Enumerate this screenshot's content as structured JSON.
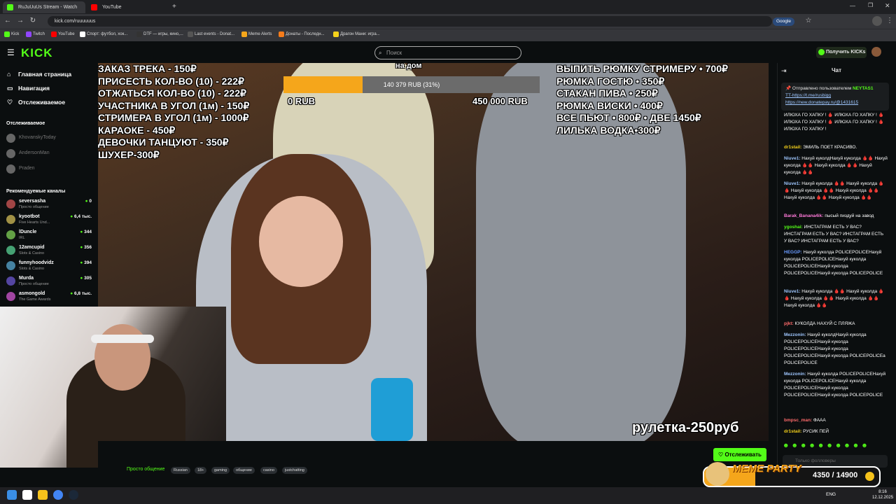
{
  "browser": {
    "tabs": [
      {
        "title": "RuJuUuUs Stream - Watch",
        "icon_color": "#53fc18"
      },
      {
        "title": "YouTube",
        "icon_color": "#ff0000"
      }
    ],
    "url": "kick.com/ruuuuuus",
    "google_badge": "Google",
    "bookmarks": [
      {
        "label": "Kick",
        "icon_color": "#53fc18"
      },
      {
        "label": "Twitch",
        "icon_color": "#9146ff"
      },
      {
        "label": "YouTube",
        "icon_color": "#ff0000"
      },
      {
        "label": "Спорт: футбол, хок...",
        "icon_color": "#ffffff"
      },
      {
        "label": "DTF — игры, кино,...",
        "icon_color": "#333333"
      },
      {
        "label": "Last events - Donat...",
        "icon_color": "#555555"
      },
      {
        "label": "Meme Alerts",
        "icon_color": "#f5a61b"
      },
      {
        "label": "Донаты - Последн...",
        "icon_color": "#f57c1b"
      },
      {
        "label": "Драгон Мани: игра...",
        "icon_color": "#f5d21b"
      }
    ]
  },
  "header": {
    "logo": "KICK",
    "search_placeholder": "Поиск",
    "get_kicks": "Получить KICKs"
  },
  "sidebar": {
    "nav": [
      "Главная страница",
      "Навигация",
      "Отслеживаемое"
    ],
    "following_title": "Отслеживаемое",
    "following": [
      "KhovanskyToday",
      "AndersonMan",
      "Praden"
    ],
    "recommended_title": "Рекомендуемые каналы",
    "recommended": [
      {
        "name": "seversasha",
        "category": "Просто общение",
        "viewers": "0"
      },
      {
        "name": "kyootbot",
        "category": "Five Hearts Und...",
        "viewers": "6,4 тыс."
      },
      {
        "name": "lDuncle",
        "category": "IRL",
        "viewers": "344"
      },
      {
        "name": "12amcupid",
        "category": "Slots & Casino",
        "viewers": "356"
      },
      {
        "name": "funnyhoodvidz",
        "category": "Slots & Casino",
        "viewers": "394"
      },
      {
        "name": "Murda",
        "category": "Просто общение",
        "viewers": "305"
      },
      {
        "name": "asmongold",
        "category": "The Game Awards",
        "viewers": "6,8 тыс."
      }
    ]
  },
  "stream": {
    "price_list_left": [
      "ЗАКАЗ ТРЕКА - 150₽",
      "ПРИСЕСТЬ КОЛ-ВО (10) - 222₽",
      "ОТЖАТЬСЯ КОЛ-ВО (10) - 222₽",
      "УЧАСТНИКА В УГОЛ (1м)  - 150₽",
      "СТРИМЕРА В УГОЛ (1м) - 1000₽",
      "КАРАОКЕ - 450₽",
      "ДЕВОЧКИ ТАНЦУЮТ - 350₽",
      "ШУХЕР-300₽"
    ],
    "price_list_right": [
      "ВЫПИТЬ РЮМКУ СТРИМЕРУ • 700₽",
      "РЮМКА ГОСТЮ • 350₽",
      "СТАКАН ПИВА • 250₽",
      "РЮМКА ВИСКИ • 400₽",
      "ВСЕ ПЬЮТ • 800₽ • ДВЕ 1450₽",
      "ЛИЛЬКА ВОДКА•300₽"
    ],
    "donation_goal_title": "на дом",
    "donation_progress_text": "140 379 RUB (31%)",
    "donation_progress": 0.31,
    "donation_min": "0 RUB",
    "donation_max": "450 000 RUB",
    "roulette": "рулетка-250руб",
    "follow_button": "Отслеживать",
    "category": "Просто общение",
    "tags": [
      "Russian",
      "18+",
      "gaming",
      "общение",
      "casino",
      "justchatting"
    ]
  },
  "chat": {
    "title": "Чат",
    "pinned_by": "Отправлено пользователем",
    "pinned_user": "NEYTAS1",
    "pinned_lines": [
      "TT-https://t.me/rusbigg",
      "https://new.donatepay.ru/@1431615"
    ],
    "messages": [
      {
        "user": "",
        "text": "ИЛЮХА ГО ХАПКУ ! 🩸 ИЛЮХА ГО ХАПКУ ! 🩸 ИЛЮХА ГО ХАПКУ ! 🩸 ИЛЮХА ГО ХАПКУ ! 🩸 ИЛЮХА ГО ХАПКУ !",
        "color": "#ffffff"
      },
      {
        "user": "dr1stail:",
        "text": "ЭМИЛЬ ПОЕТ КРАСИВО.",
        "color": "#f5d21b"
      },
      {
        "user": "Niuve1:",
        "text": "Нахуй куколдНахуй куколда 🩸🩸 Нахуй куколда 🩸🩸 Нахуй куколда 🩸🩸 Нахуй куколда 🩸🩸",
        "color": "#9fc7ff"
      },
      {
        "user": "Niuve1:",
        "text": "Нахуй куколда 🩸🩸 Нахуй куколда 🩸🩸 Нахуй куколда 🩸🩸 Нахуй куколда 🩸🩸 Нахуй куколда 🩸🩸 Нахуй куколда 🩸🩸",
        "color": "#9fc7ff"
      },
      {
        "user": "Barak_Banana4ik:",
        "text": "пысый пиздуй на завод",
        "color": "#ff7ad9"
      },
      {
        "user": "ygoshai:",
        "text": "ИНСТАГРАМ ЕСТЬ У ВАС? ИНСТАГРАМ ЕСТЬ У ВАС? ИНСТАГРАМ ЕСТЬ У ВАС? ИНСТАГРАМ ЕСТЬ У ВАС?",
        "color": "#53fc18"
      },
      {
        "user": "HEGGP:",
        "text": "Нахуй куколда POLICEPOLICEНахуй куколда POLICEPOLICEНахуй куколда POLICEPOLICEНахуй куколда POLICEPOLICEНахуй куколда POLICEPOLICE",
        "color": "#6a9bff"
      },
      {
        "user": "Niuve1:",
        "text": "Нахуй куколда 🩸🩸 Нахуй куколда 🩸🩸 Нахуй куколда 🩸🩸 Нахуй куколда 🩸🩸 Нахуй куколда 🩸🩸",
        "color": "#9fc7ff"
      },
      {
        "user": "pjkt:",
        "text": "КУКОЛДА НАХУЙ С ПЛЯЖА",
        "color": "#ff6b6b"
      },
      {
        "user": "Mezzonin:",
        "text": "Нахуй куколдНахуй куколда POLICEPOLICEНахуй куколда POLICEPOLICEНахуй куколда POLICEPOLICEНахуй куколда POLICEPOLICEa POLICEPOLICE",
        "color": "#9fc7ff"
      },
      {
        "user": "Mezzonin:",
        "text": "Нахуй куколда POLICEPOLICEНахуй куколда POLICEPOLICEНахуй куколда POLICEPOLICEНахуй куколда POLICEPOLICEНахуй куколда POLICEPOLICE",
        "color": "#9fc7ff"
      },
      {
        "user": "bmpsc_man:",
        "text": "ФААА",
        "color": "#ff6b6b"
      },
      {
        "user": "dr1stail:",
        "text": "РУСИК ПЕЙ",
        "color": "#f5d21b"
      }
    ],
    "input_placeholder": "Только фолловеры"
  },
  "meme_party": {
    "title": "MEME PARTY",
    "count": "4350 / 14900",
    "progress": 0.29
  },
  "taskbar": {
    "lang": "ENG",
    "time": "8:16",
    "date": "12.12.2025"
  }
}
